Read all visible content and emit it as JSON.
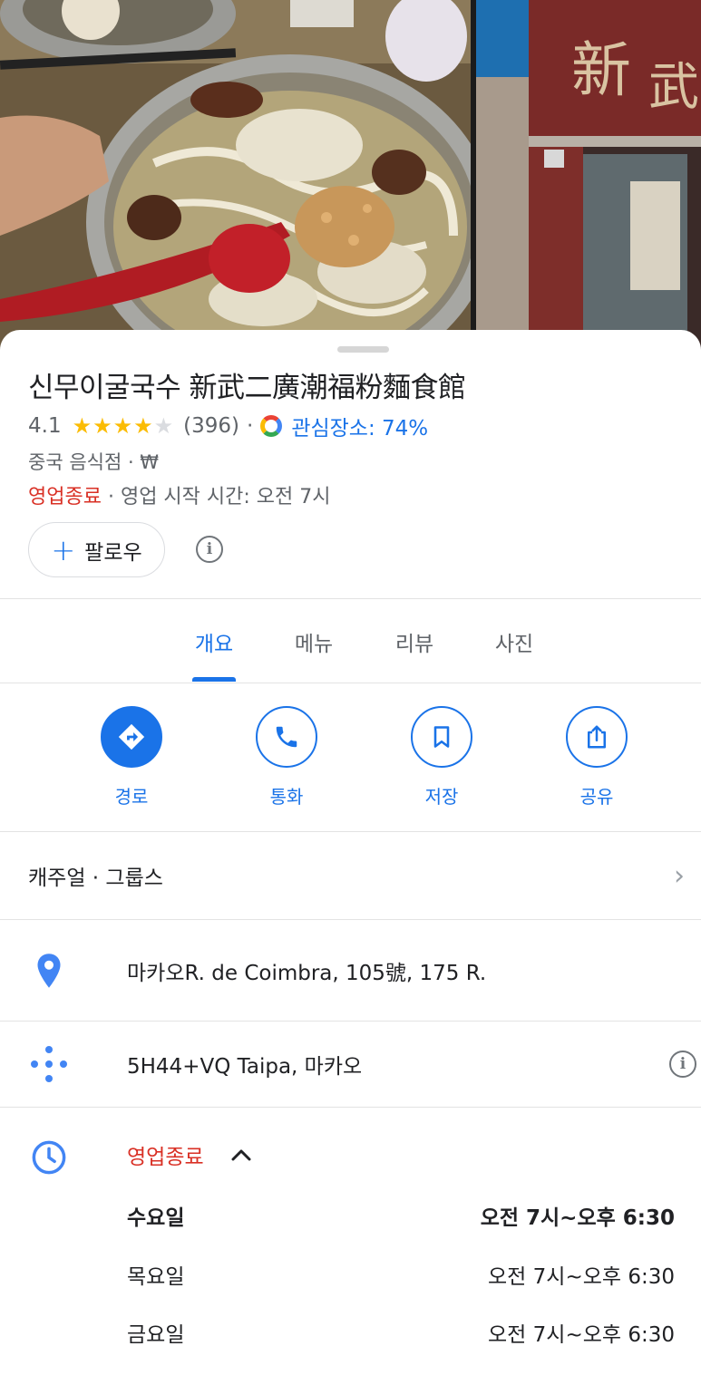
{
  "place": {
    "title": "신무이굴국수 新武二廣潮福粉麵食館",
    "rating": "4.1",
    "stars_filled": 4,
    "stars_total": 5,
    "review_count": "(396)",
    "interest": "관심장소: 74%",
    "category": "중국 음식점 · ₩",
    "status_closed": "영업종료",
    "status_detail": " · 영업 시작 시간: 오전 7시"
  },
  "follow": {
    "label": "팔로우"
  },
  "tabs": [
    {
      "label": "개요",
      "active": true
    },
    {
      "label": "메뉴",
      "active": false
    },
    {
      "label": "리뷰",
      "active": false
    },
    {
      "label": "사진",
      "active": false
    }
  ],
  "actions": [
    {
      "label": "경로",
      "icon": "directions-icon"
    },
    {
      "label": "통화",
      "icon": "phone-icon"
    },
    {
      "label": "저장",
      "icon": "bookmark-icon"
    },
    {
      "label": "공유",
      "icon": "share-icon"
    }
  ],
  "attributes": {
    "text": "캐주얼 · 그룹스"
  },
  "address": {
    "text": "마카오R. de Coimbra, 105號, 175 R."
  },
  "plus_code": {
    "text": "5H44+VQ Taipa, 마카오"
  },
  "hours": {
    "status": "영업종료",
    "days": [
      {
        "day": "수요일",
        "time": "오전 7시~오후 6:30",
        "today": true
      },
      {
        "day": "목요일",
        "time": "오전 7시~오후 6:30",
        "today": false
      },
      {
        "day": "금요일",
        "time": "오전 7시~오후 6:30",
        "today": false
      }
    ]
  },
  "colors": {
    "accent": "#1a73e8",
    "closed": "#d93025",
    "star": "#fbbc04"
  }
}
